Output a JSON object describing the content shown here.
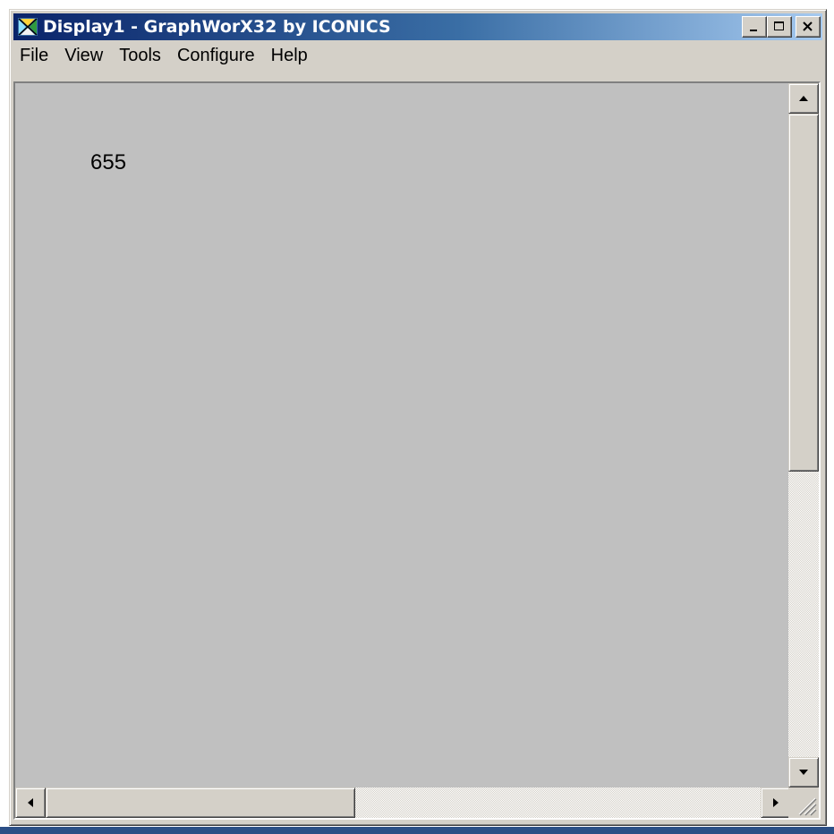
{
  "window": {
    "title": "Display1 - GraphWorX32 by ICONICS",
    "icon": "graphworx-app-icon",
    "controls": {
      "minimize_label": "_",
      "maximize_label": "□",
      "close_label": "✕"
    }
  },
  "menubar": {
    "items": [
      {
        "label": "File"
      },
      {
        "label": "View"
      },
      {
        "label": "Tools"
      },
      {
        "label": "Configure"
      },
      {
        "label": "Help"
      }
    ]
  },
  "display": {
    "value_text": "655",
    "background_color": "#c0c0c0"
  },
  "scrollbars": {
    "vertical": {
      "position_fraction": 0.0
    },
    "horizontal": {
      "position_fraction": 0.0
    }
  },
  "colors": {
    "title_active_start": "#0a246a",
    "title_active_end": "#a6caf0",
    "face": "#d4d0c8"
  }
}
